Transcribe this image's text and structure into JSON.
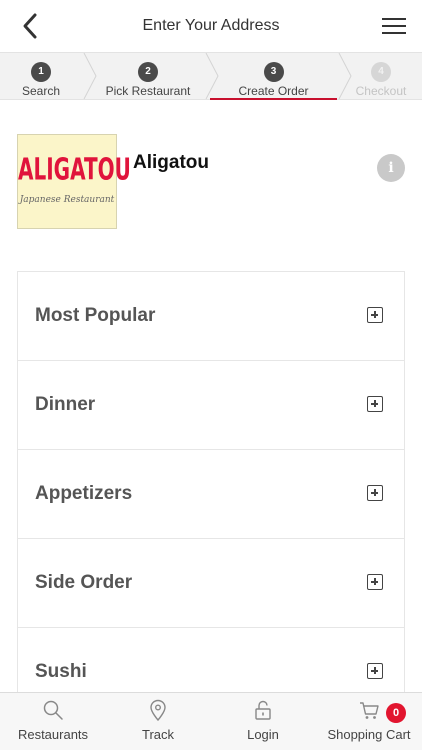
{
  "header": {
    "title": "Enter Your Address",
    "back_icon": "chevron-left-icon",
    "menu_icon": "hamburger-menu-icon"
  },
  "steps": [
    {
      "number": "1",
      "label": "Search",
      "state": "done"
    },
    {
      "number": "2",
      "label": "Pick Restaurant",
      "state": "done"
    },
    {
      "number": "3",
      "label": "Create Order",
      "state": "active"
    },
    {
      "number": "4",
      "label": "Checkout",
      "state": "disabled"
    }
  ],
  "restaurant": {
    "name": "Aligatou",
    "logo_text": "ALIGATOU",
    "logo_subtext": "Japanese Restaurant",
    "info_icon": "info-icon"
  },
  "categories": [
    {
      "label": "Most Popular"
    },
    {
      "label": "Dinner"
    },
    {
      "label": "Appetizers"
    },
    {
      "label": "Side Order"
    },
    {
      "label": "Sushi"
    }
  ],
  "tabbar": {
    "items": [
      {
        "label": "Restaurants",
        "icon": "search-icon"
      },
      {
        "label": "Track",
        "icon": "location-pin-icon"
      },
      {
        "label": "Login",
        "icon": "unlock-icon"
      },
      {
        "label": "Shopping Cart",
        "icon": "cart-icon"
      }
    ],
    "cart_count": "0"
  },
  "colors": {
    "accent": "#c8102e",
    "badge": "#e2152f",
    "step_done": "#4a4a4a",
    "step_disabled": "#d6d6d6"
  }
}
